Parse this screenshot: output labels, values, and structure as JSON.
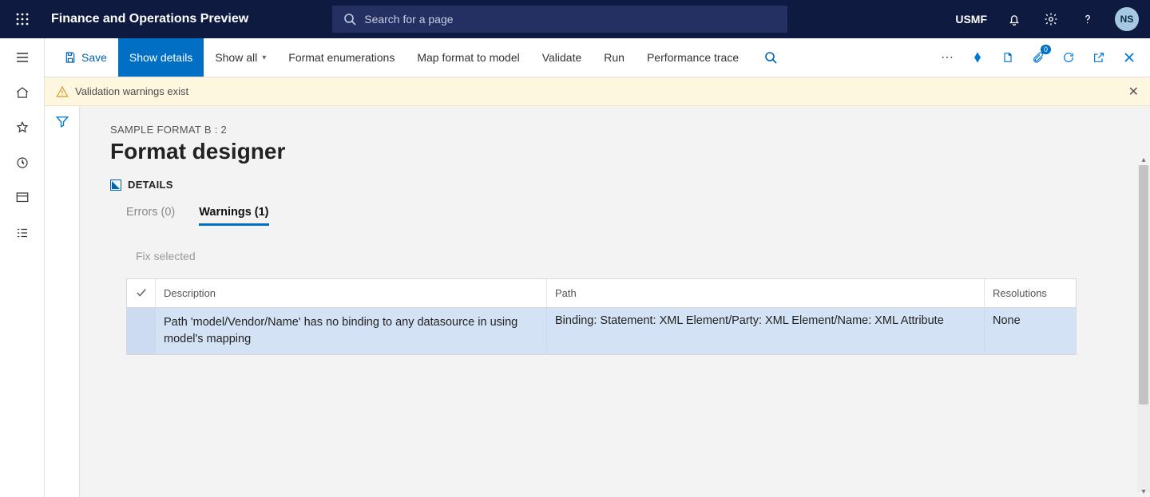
{
  "header": {
    "app_title": "Finance and Operations Preview",
    "search_placeholder": "Search for a page",
    "company": "USMF",
    "avatar_initials": "NS"
  },
  "commands": {
    "save": "Save",
    "show_details": "Show details",
    "show_all": "Show all",
    "format_enumerations": "Format enumerations",
    "map_format": "Map format to model",
    "validate": "Validate",
    "run": "Run",
    "perf_trace": "Performance trace",
    "attachments_badge": "0"
  },
  "banner": {
    "text": "Validation warnings exist"
  },
  "page": {
    "breadcrumb": "SAMPLE FORMAT B : 2",
    "title": "Format designer",
    "details_label": "DETAILS",
    "tabs": {
      "errors": "Errors (0)",
      "warnings": "Warnings (1)"
    },
    "fix_selected": "Fix selected",
    "grid": {
      "headers": {
        "description": "Description",
        "path": "Path",
        "resolutions": "Resolutions"
      },
      "rows": [
        {
          "description": "Path 'model/Vendor/Name' has no binding to any datasource in using model's mapping",
          "path": "Binding: Statement: XML Element/Party: XML Element/Name: XML Attribute",
          "resolutions": "None"
        }
      ]
    }
  }
}
